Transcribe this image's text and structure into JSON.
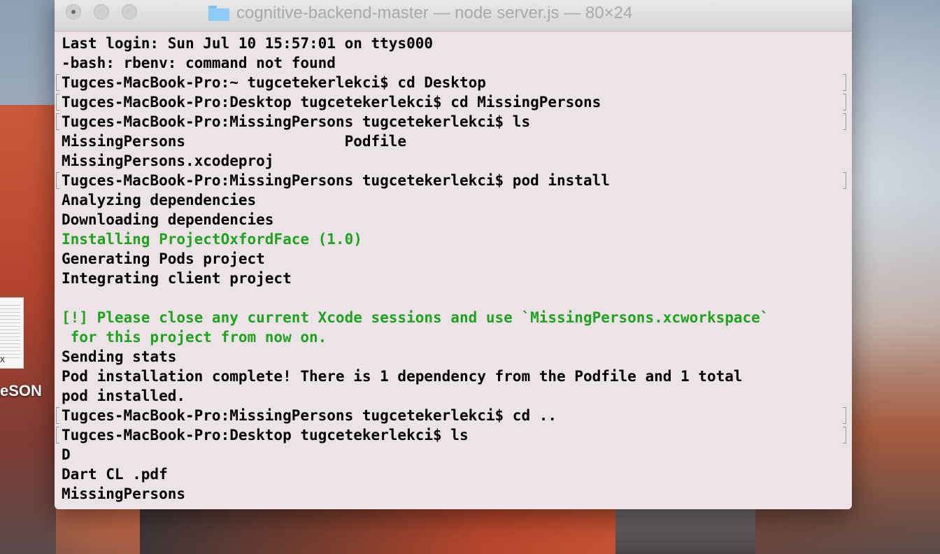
{
  "desktop": {
    "file_extension": "x",
    "label": "eSON"
  },
  "window": {
    "title": "cognitive-backend-master — node server.js — 80×24",
    "folder_icon": "folder-icon",
    "controls": [
      "close-button",
      "minimize-button",
      "zoom-button"
    ]
  },
  "terminal": {
    "text_color": "#000000",
    "highlight_color": "#1fa31f",
    "background": "#ece3e6",
    "lines": [
      {
        "text": "Last login: Sun Jul 10 15:57:01 on ttys000",
        "style": "normal",
        "marked": false
      },
      {
        "text": "-bash: rbenv: command not found",
        "style": "normal",
        "marked": false
      },
      {
        "text": "Tugces-MacBook-Pro:~ tugcetekerlekci$ cd Desktop",
        "style": "normal",
        "marked": true
      },
      {
        "text": "Tugces-MacBook-Pro:Desktop tugcetekerlekci$ cd MissingPersons",
        "style": "normal",
        "marked": true
      },
      {
        "text": "Tugces-MacBook-Pro:MissingPersons tugcetekerlekci$ ls",
        "style": "normal",
        "marked": true
      },
      {
        "text": "MissingPersons                  Podfile",
        "style": "normal",
        "marked": false
      },
      {
        "text": "MissingPersons.xcodeproj",
        "style": "normal",
        "marked": false
      },
      {
        "text": "Tugces-MacBook-Pro:MissingPersons tugcetekerlekci$ pod install",
        "style": "normal",
        "marked": true
      },
      {
        "text": "Analyzing dependencies",
        "style": "normal",
        "marked": false
      },
      {
        "text": "Downloading dependencies",
        "style": "normal",
        "marked": false
      },
      {
        "text": "Installing ProjectOxfordFace (1.0)",
        "style": "green",
        "marked": false
      },
      {
        "text": "Generating Pods project",
        "style": "normal",
        "marked": false
      },
      {
        "text": "Integrating client project",
        "style": "normal",
        "marked": false
      },
      {
        "text": "",
        "style": "normal",
        "marked": false
      },
      {
        "text": "[!] Please close any current Xcode sessions and use `MissingPersons.xcworkspace`",
        "style": "green",
        "marked": false
      },
      {
        "text": " for this project from now on.",
        "style": "green",
        "marked": false
      },
      {
        "text": "Sending stats",
        "style": "normal",
        "marked": false
      },
      {
        "text": "Pod installation complete! There is 1 dependency from the Podfile and 1 total",
        "style": "normal",
        "marked": false
      },
      {
        "text": "pod installed.",
        "style": "normal",
        "marked": false
      },
      {
        "text": "Tugces-MacBook-Pro:MissingPersons tugcetekerlekci$ cd ..",
        "style": "normal",
        "marked": true
      },
      {
        "text": "Tugces-MacBook-Pro:Desktop tugcetekerlekci$ ls",
        "style": "normal",
        "marked": true
      },
      {
        "text": "D",
        "style": "normal",
        "marked": false
      },
      {
        "text": "Dart CL .pdf",
        "style": "normal",
        "marked": false
      },
      {
        "text": "MissingPersons",
        "style": "normal",
        "marked": false
      }
    ]
  }
}
